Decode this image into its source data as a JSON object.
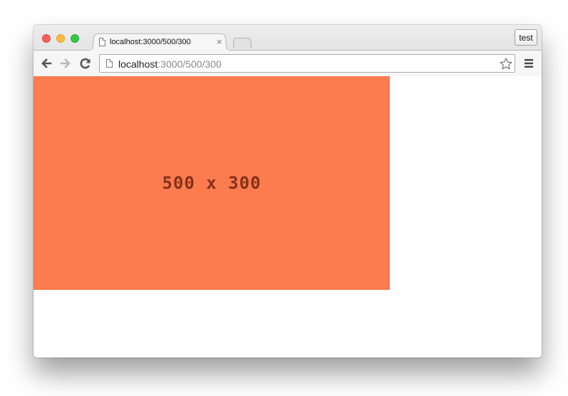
{
  "window": {
    "tab": {
      "title": "localhost:3000/500/300",
      "close_glyph": "×",
      "icon": "page-icon"
    },
    "profile_label": "test"
  },
  "toolbar": {
    "url_host": "localhost",
    "url_path": ":3000/500/300",
    "back_icon": "arrow-left-icon",
    "forward_icon": "arrow-right-icon",
    "reload_icon": "reload-icon",
    "bookmark_icon": "star-icon",
    "menu_icon": "hamburger-menu-icon"
  },
  "page": {
    "image_label": "500 x 300",
    "image_color": "#fc7b4f",
    "label_color": "#843218"
  },
  "colors": {
    "close": "#fc605c",
    "minimize": "#fdbc40",
    "maximize": "#34c84a"
  }
}
